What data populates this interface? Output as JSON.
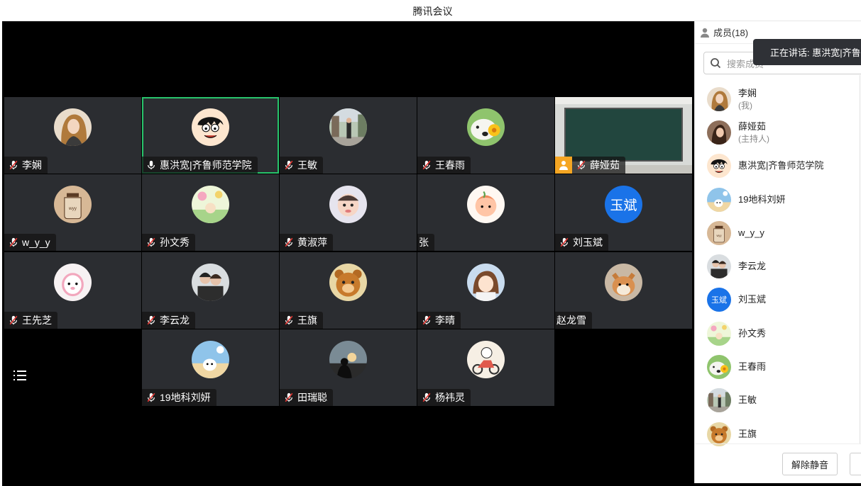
{
  "window": {
    "title": "腾讯会议"
  },
  "grid": {
    "tiles": [
      {
        "name": "李娴",
        "muted": true,
        "avatar": "woman-long-hair-avatar",
        "col": 0,
        "row": 0
      },
      {
        "name": "惠洪宽|齐鲁师范学院",
        "muted": false,
        "active": true,
        "avatar": "luffy-cartoon-avatar",
        "col": 1,
        "row": 0
      },
      {
        "name": "王敏",
        "muted": true,
        "avatar": "street-photo-avatar",
        "col": 2,
        "row": 0
      },
      {
        "name": "王春雨",
        "muted": true,
        "avatar": "dog-flower-avatar",
        "col": 3,
        "row": 0
      },
      {
        "name": "薛娅茹",
        "muted": true,
        "host": true,
        "video": "classroom-blackboard",
        "col": 4,
        "row": 0
      },
      {
        "name": "w_y_y",
        "muted": true,
        "avatar": "jar-drawing-avatar",
        "col": 0,
        "row": 1
      },
      {
        "name": "孙文秀",
        "muted": true,
        "avatar": "garden-cartoon-avatar",
        "col": 1,
        "row": 1
      },
      {
        "name": "黄淑萍",
        "muted": true,
        "avatar": "baby-avatar",
        "col": 2,
        "row": 1
      },
      {
        "name": "张",
        "muted": false,
        "avatar": "peach-girl-avatar",
        "col": 3,
        "row": 1
      },
      {
        "name": "刘玉斌",
        "muted": true,
        "avatar_text": "玉斌",
        "col": 4,
        "row": 1
      },
      {
        "name": "王先芝",
        "muted": true,
        "avatar": "pink-bunny-avatar",
        "col": 0,
        "row": 2
      },
      {
        "name": "李云龙",
        "muted": true,
        "avatar": "couple-photo-avatar",
        "col": 1,
        "row": 2
      },
      {
        "name": "王旗",
        "muted": true,
        "avatar": "bear-cartoon-avatar",
        "col": 2,
        "row": 2
      },
      {
        "name": "李晴",
        "muted": true,
        "avatar": "girl-cartoon-avatar",
        "col": 3,
        "row": 2
      },
      {
        "name": "赵龙雪",
        "muted": false,
        "avatar": "shiba-dog-avatar",
        "col": 4,
        "row": 2
      },
      {
        "name": "19地科刘妍",
        "muted": true,
        "avatar": "beach-cartoon-avatar",
        "col": 1,
        "row": 3
      },
      {
        "name": "田瑞聪",
        "muted": true,
        "avatar": "sunset-silhouette-avatar",
        "col": 2,
        "row": 3
      },
      {
        "name": "杨祎灵",
        "muted": true,
        "avatar": "scooter-cartoon-avatar",
        "col": 3,
        "row": 3
      }
    ]
  },
  "panel": {
    "header": "成员(18)",
    "search_placeholder": "搜索成员",
    "speaking_label": "正在讲话: 惠洪宽|齐鲁师范学院",
    "members": [
      {
        "name": "李娴",
        "sub": "(我)",
        "avatar": "woman-long-hair-avatar"
      },
      {
        "name": "薛娅茹",
        "sub": "(主持人)",
        "avatar": "woman-photo-avatar"
      },
      {
        "name": "惠洪宽|齐鲁师范学院",
        "avatar": "luffy-cartoon-avatar"
      },
      {
        "name": "19地科刘妍",
        "avatar": "beach-cartoon-avatar"
      },
      {
        "name": "w_y_y",
        "avatar": "jar-drawing-avatar"
      },
      {
        "name": "李云龙",
        "avatar": "couple-photo-avatar"
      },
      {
        "name": "刘玉斌",
        "avatar_text": "玉斌"
      },
      {
        "name": "孙文秀",
        "avatar": "garden-cartoon-avatar"
      },
      {
        "name": "王春雨",
        "avatar": "dog-flower-avatar"
      },
      {
        "name": "王敏",
        "avatar": "street-photo-avatar"
      },
      {
        "name": "王旗",
        "avatar": "bear-cartoon-avatar"
      }
    ],
    "unmute_button": "解除静音"
  },
  "colors": {
    "active_border": "#27c36b",
    "host_badge": "#f5a623",
    "avatar_blue": "#1a73e8",
    "tile_bg": "#2b2d31"
  }
}
